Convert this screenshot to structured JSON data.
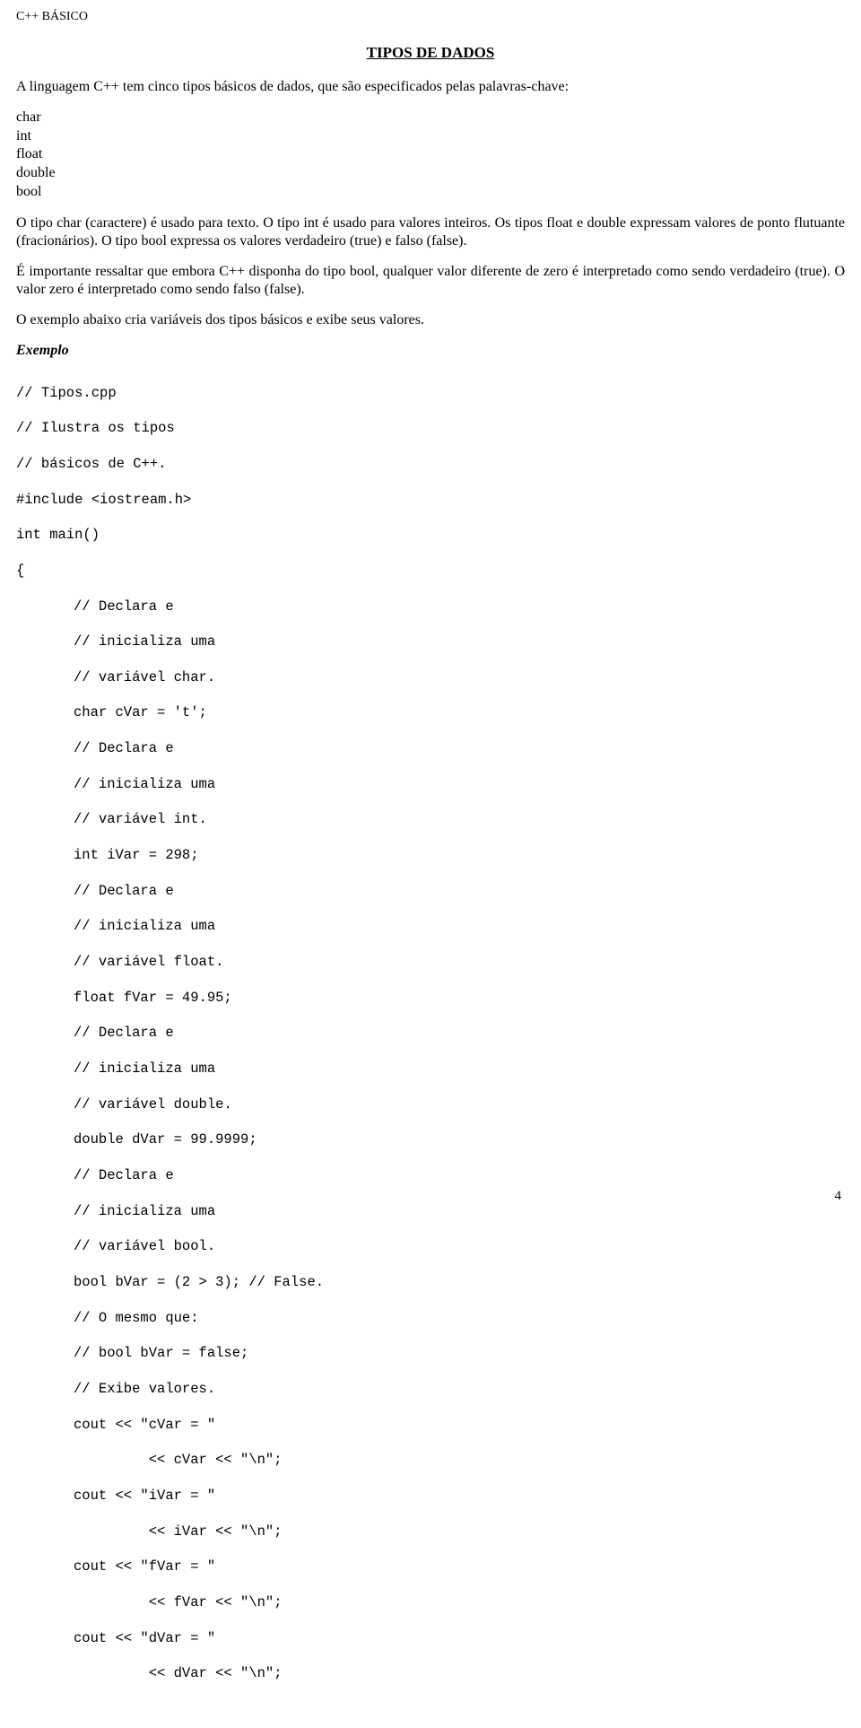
{
  "header": "C++ BÁSICO",
  "title": "TIPOS DE DADOS",
  "para1": "A linguagem C++ tem cinco tipos básicos de dados, que são especificados pelas palavras-chave:",
  "types": {
    "t1": "char",
    "t2": "int",
    "t3": "float",
    "t4": "double",
    "t5": "bool"
  },
  "para2": "O tipo char (caractere) é usado para texto. O tipo int é usado para valores inteiros. Os tipos float e double expressam valores de ponto flutuante (fracionários). O tipo bool expressa os valores verdadeiro (true) e falso (false).",
  "para3": "É importante ressaltar que embora C++ disponha do tipo bool, qualquer valor diferente de zero é interpretado como sendo verdadeiro (true). O valor zero é interpretado como sendo falso (false).",
  "para4": "O exemplo abaixo cria variáveis dos tipos básicos e exibe seus valores.",
  "exemplo_label": "Exemplo",
  "code": {
    "l1": "// Tipos.cpp",
    "l2": "// Ilustra os tipos",
    "l3": "// básicos de C++.",
    "l4": "#include <iostream.h>",
    "l5": "int main()",
    "l6": "{",
    "l7": "// Declara e",
    "l8": "// inicializa uma",
    "l9": "// variável char.",
    "l10": "char cVar = 't';",
    "l11": "// Declara e",
    "l12": "// inicializa uma",
    "l13": "// variável int.",
    "l14": "int iVar = 298;",
    "l15": "// Declara e",
    "l16": "// inicializa uma",
    "l17": "// variável float.",
    "l18": "float fVar = 49.95;",
    "l19": "// Declara e",
    "l20": "// inicializa uma",
    "l21": "// variável double.",
    "l22": "double dVar = 99.9999;",
    "l23": "// Declara e",
    "l24": "// inicializa uma",
    "l25": "// variável bool.",
    "l26": "bool bVar = (2 > 3); // False.",
    "l27": "// O mesmo que:",
    "l28": "// bool bVar = false;",
    "l29": "// Exibe valores.",
    "l30": "cout << \"cVar = \"",
    "l31": "         << cVar << \"\\n\";",
    "l32": "cout << \"iVar = \"",
    "l33": "         << iVar << \"\\n\";",
    "l34": "cout << \"fVar = \"",
    "l35": "         << fVar << \"\\n\";",
    "l36": "cout << \"dVar = \"",
    "l37": "         << dVar << \"\\n\";"
  },
  "page_num": "4"
}
